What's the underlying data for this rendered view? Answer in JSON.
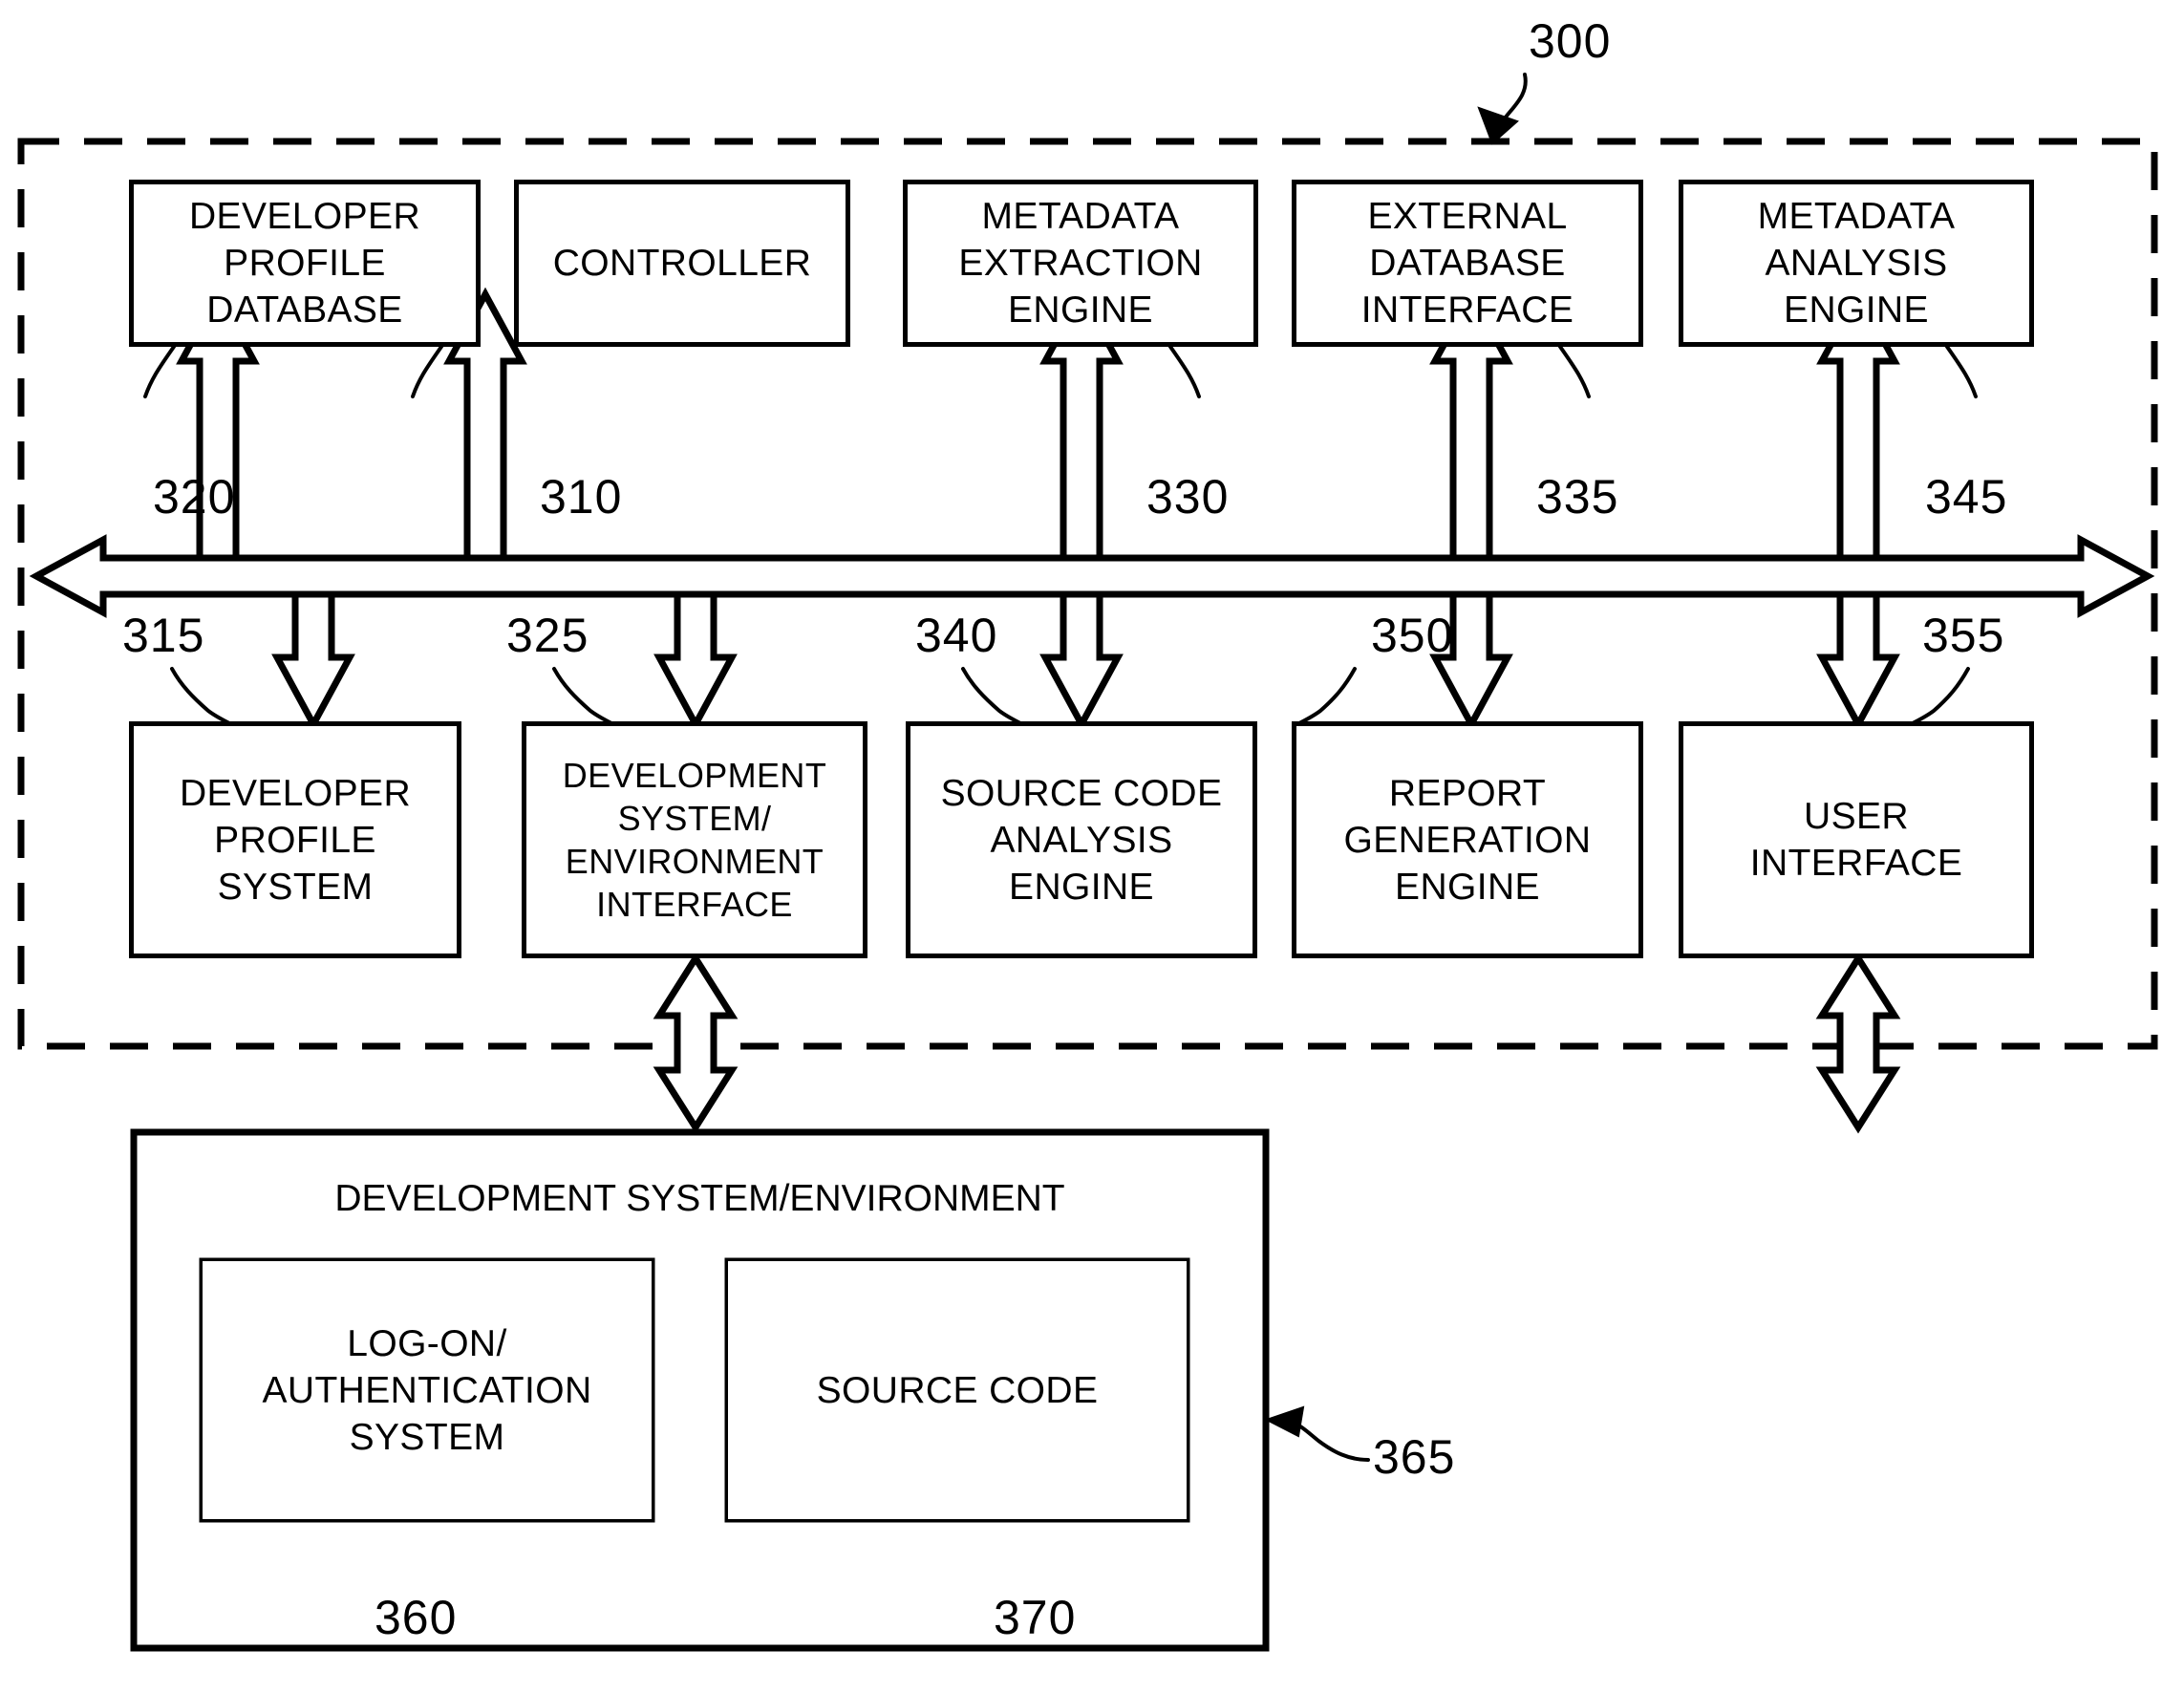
{
  "figure": {
    "number_label": "300",
    "dashed_boundary_name": "system-boundary"
  },
  "top_row_boxes": [
    {
      "id": "developer-profile-database",
      "label": "DEVELOPER\nPROFILE\nDATABASE",
      "ref": "320"
    },
    {
      "id": "controller",
      "label": "CONTROLLER",
      "ref": "310"
    },
    {
      "id": "metadata-extraction-engine",
      "label": "METADATA\nEXTRACTION\nENGINE",
      "ref": "330"
    },
    {
      "id": "external-database-interface",
      "label": "EXTERNAL\nDATABASE\nINTERFACE",
      "ref": "335"
    },
    {
      "id": "metadata-analysis-engine",
      "label": "METADATA\nANALYSIS\nENGINE",
      "ref": "345"
    }
  ],
  "bottom_row_boxes": [
    {
      "id": "developer-profile-system",
      "label": "DEVELOPER\nPROFILE\nSYSTEM",
      "ref": "315"
    },
    {
      "id": "development-system-environment-interface",
      "label": "DEVELOPMENT\nSYSTEM/\nENVIRONMENT\nINTERFACE",
      "ref": "325"
    },
    {
      "id": "source-code-analysis-engine",
      "label": "SOURCE CODE\nANALYSIS\nENGINE",
      "ref": "340"
    },
    {
      "id": "report-generation-engine",
      "label": "REPORT\nGENERATION\nENGINE",
      "ref": "350"
    },
    {
      "id": "user-interface",
      "label": "USER\nINTERFACE",
      "ref": "355"
    }
  ],
  "development_environment": {
    "title": "DEVELOPMENT SYSTEM/ENVIRONMENT",
    "ref": "365",
    "children": [
      {
        "id": "log-on-authentication-system",
        "label": "LOG-ON/\nAUTHENTICATION\nSYSTEM",
        "ref": "360"
      },
      {
        "id": "source-code",
        "label": "SOURCE CODE",
        "ref": "370"
      }
    ]
  },
  "colors": {
    "line": "#000000",
    "background": "#ffffff"
  }
}
